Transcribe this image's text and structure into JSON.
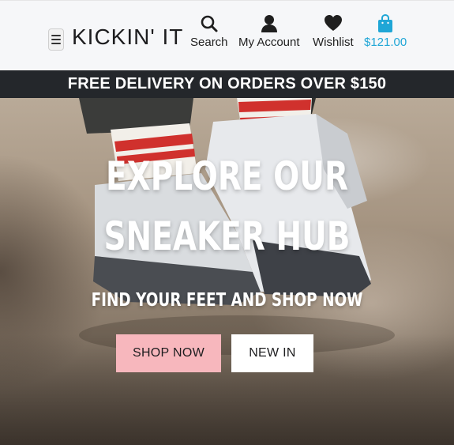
{
  "header": {
    "brand": "KICKIN' IT",
    "nav": {
      "search": "Search",
      "account": "My Account",
      "wishlist": "Wishlist",
      "cart_total": "$121.00"
    },
    "icons": {
      "menu": "hamburger-icon",
      "search": "search-icon",
      "account": "user-icon",
      "wishlist": "heart-icon",
      "cart": "shopping-bag-icon"
    },
    "cart_color": "#1fa6d6"
  },
  "banner": {
    "text": "FREE DELIVERY ON ORDERS OVER $150"
  },
  "hero": {
    "title_line1": "EXPLORE OUR",
    "title_line2": "SNEAKER HUB",
    "subtitle": "FIND YOUR FEET AND SHOP NOW",
    "buttons": {
      "shop_now": "SHOP NOW",
      "new_in": "NEW IN"
    },
    "accent_color": "#f7b7bd"
  }
}
